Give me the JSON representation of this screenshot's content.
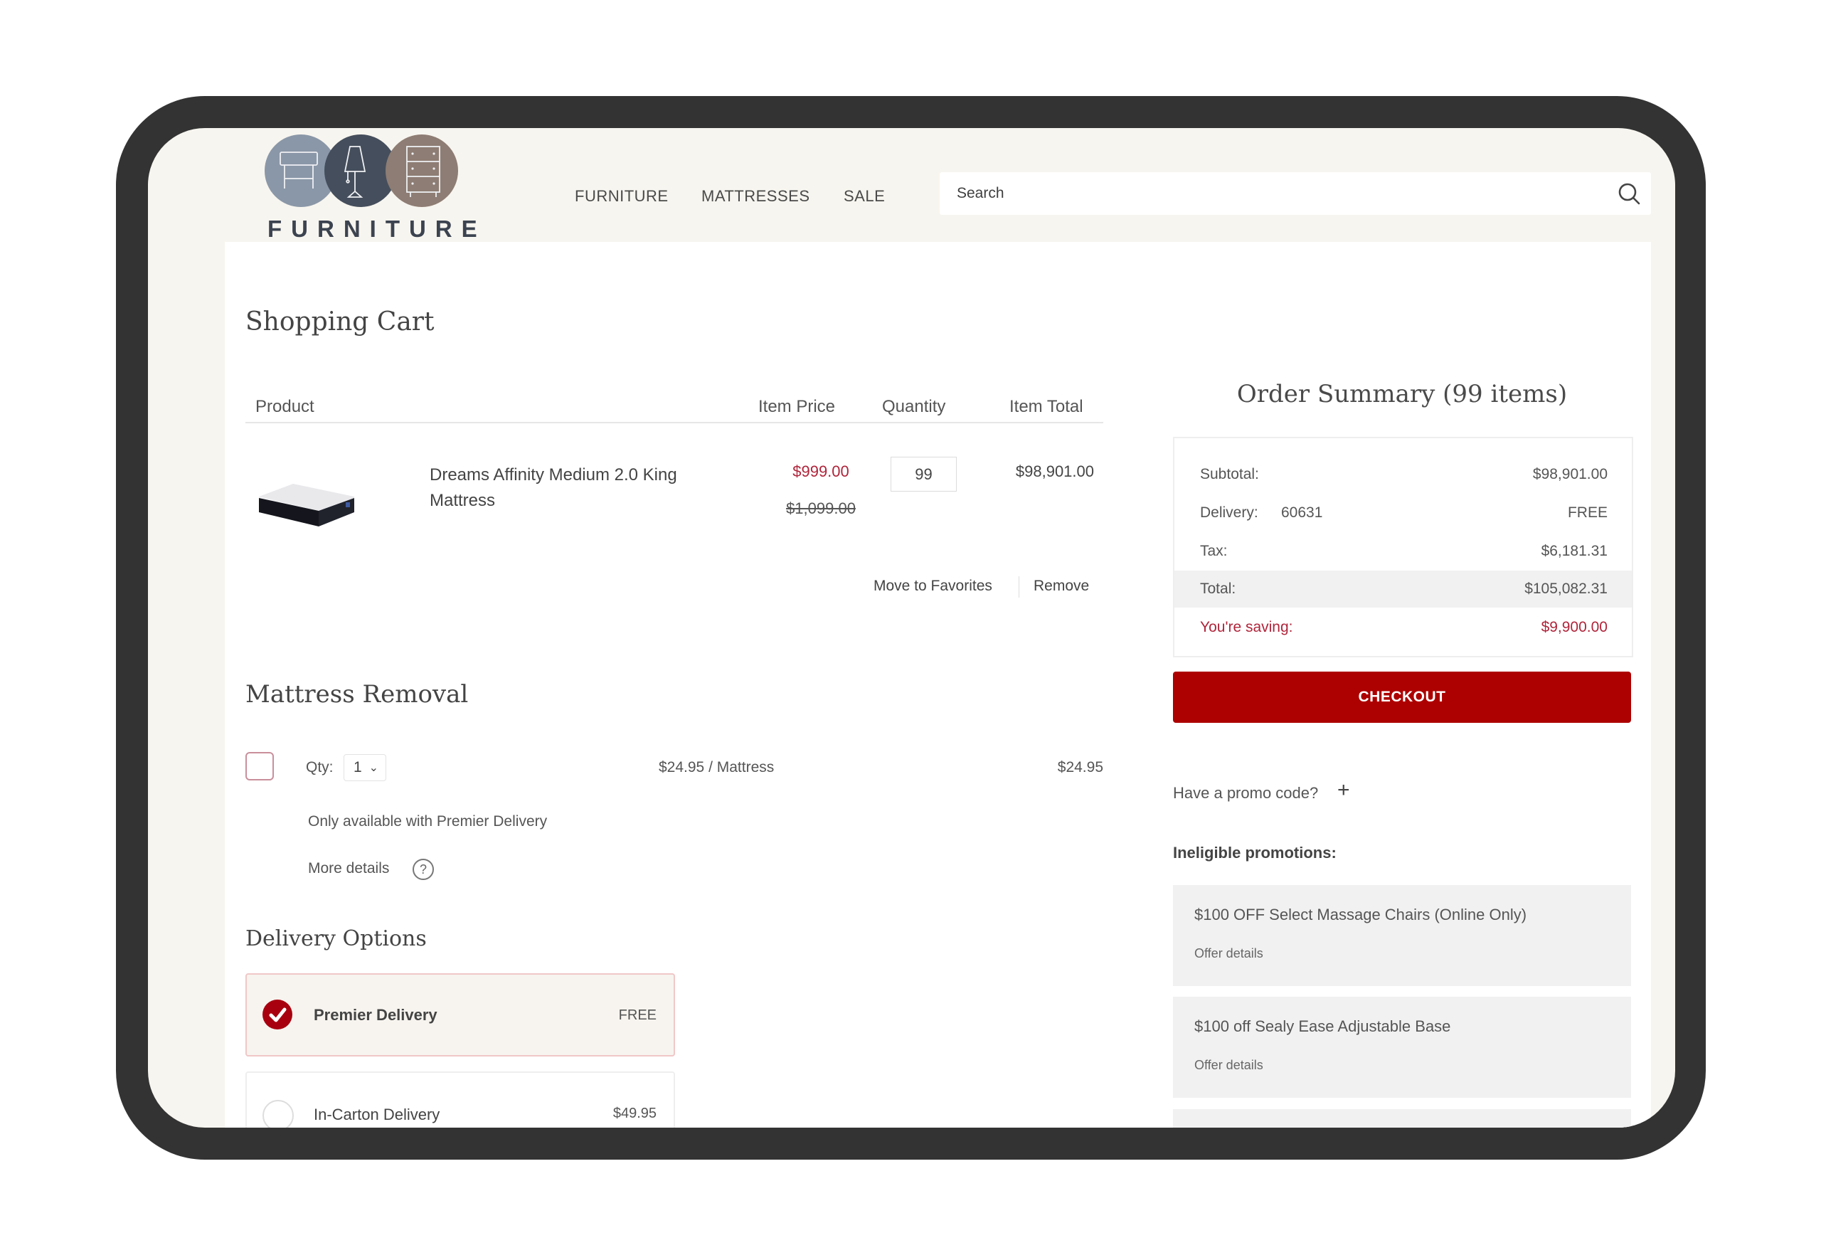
{
  "brand": {
    "logo_text": "FURNITURE"
  },
  "nav": {
    "items": [
      "FURNITURE",
      "MATTRESSES",
      "SALE"
    ]
  },
  "search": {
    "placeholder": "Search",
    "value": "",
    "icon": "search-icon"
  },
  "cart": {
    "title": "Shopping Cart",
    "columns": [
      "Product",
      "Item Price",
      "Quantity",
      "Item Total"
    ],
    "items": [
      {
        "name": "Dreams Affinity Medium 2.0 King Mattress",
        "price": "$999.00",
        "original_price": "$1,099.00",
        "quantity": "99",
        "total": "$98,901.00",
        "actions": {
          "favorite": "Move to Favorites",
          "remove": "Remove"
        }
      }
    ]
  },
  "mattress_removal": {
    "title": "Mattress Removal",
    "checked": false,
    "qty_label": "Qty:",
    "qty_value": "1",
    "unit_price": "$24.95 / Mattress",
    "price": "$24.95",
    "note": "Only available with Premier Delivery",
    "more_details": "More details",
    "help_icon": "?"
  },
  "delivery": {
    "title": "Delivery Options",
    "options": [
      {
        "name": "Premier Delivery",
        "price": "FREE",
        "selected": true
      },
      {
        "name": "In-Carton Delivery",
        "price": "$49.95",
        "selected": false
      }
    ]
  },
  "summary": {
    "title": "Order Summary (99 items)",
    "subtotal_label": "Subtotal:",
    "subtotal": "$98,901.00",
    "delivery_label": "Delivery:",
    "delivery_zip": "60631",
    "delivery": "FREE",
    "tax_label": "Tax:",
    "tax": "$6,181.31",
    "total_label": "Total:",
    "total": "$105,082.31",
    "saving_label": "You're saving:",
    "saving": "$9,900.00",
    "checkout": "CHECKOUT"
  },
  "promo": {
    "question": "Have a promo code?",
    "plus": "+",
    "ineligible_title": "Ineligible promotions:",
    "cards": [
      {
        "title": "$100 OFF Select Massage Chairs (Online Only)",
        "link": "Offer details"
      },
      {
        "title": "$100 off Sealy Ease Adjustable Base",
        "link": "Offer details"
      }
    ]
  },
  "colors": {
    "accent": "#ad0000",
    "sale_price": "#b0243a",
    "frame": "#333333",
    "page_bg": "#f7f5ef"
  }
}
